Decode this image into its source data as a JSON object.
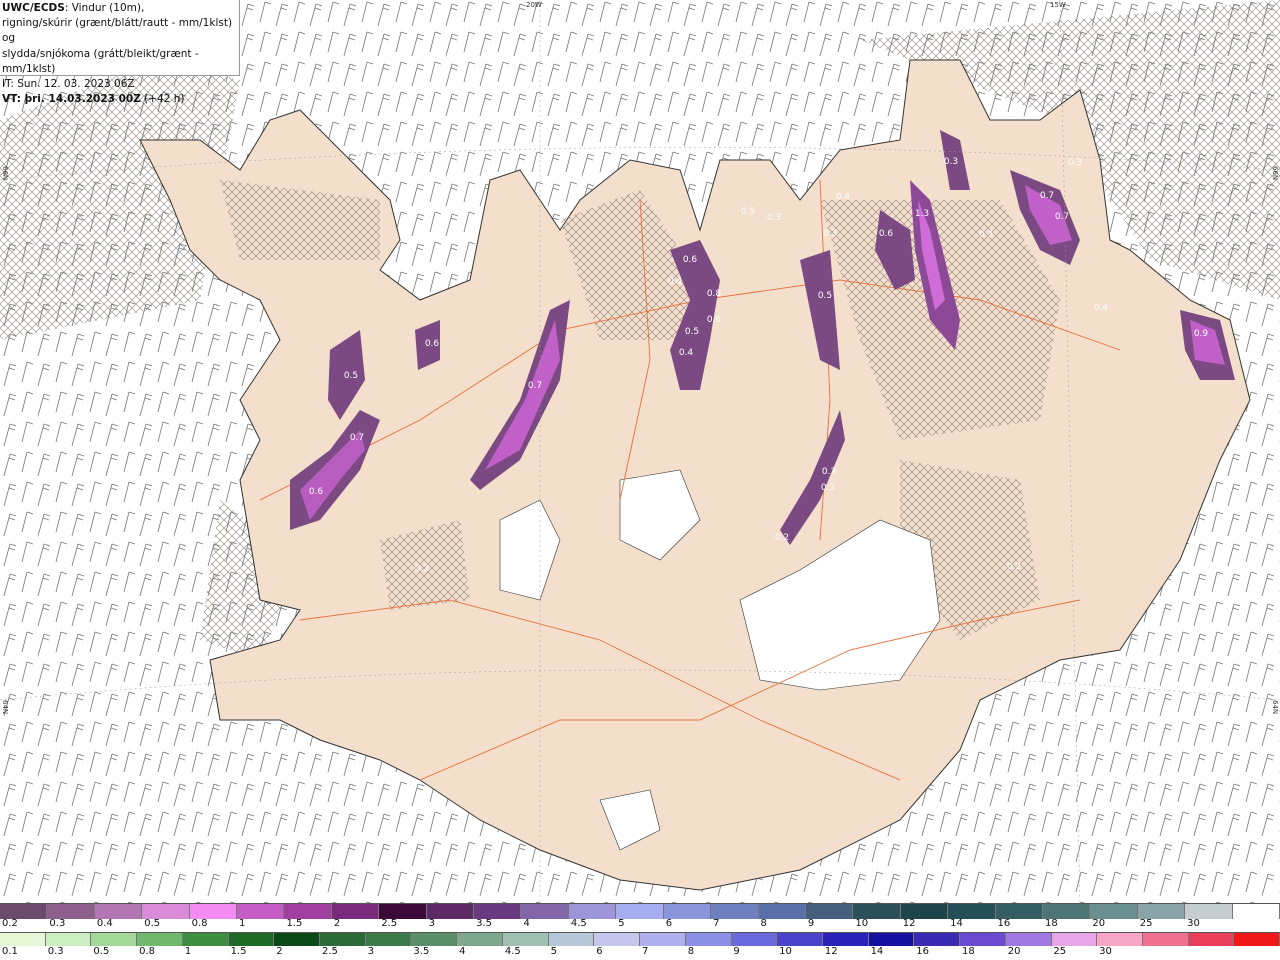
{
  "info": {
    "model": "UWC/ECDS",
    "desc_1": ": Vindur (10m),",
    "desc_2": "rigning/skúrir (grænt/blátt/rautt - mm/1klst) og",
    "desc_3": "slydda/snjókoma (grátt/bleikt/grænt - mm/1klst)",
    "it": "IT: Sun. 12. 03. 2023 06Z",
    "vt_label": "VT: þri. 14.03.2023 00Z",
    "vt_offset": " (+42 h)"
  },
  "graticule": {
    "lon_20w": "20W",
    "lon_15w": "15W",
    "lat_66n_left": "66N",
    "lat_66n_right": "66N",
    "lat_64n_left": "64N",
    "lat_64n_right": "64N"
  },
  "precip_labels": [
    {
      "text": "0.5"
    },
    {
      "text": "0.7"
    },
    {
      "text": "0.6"
    },
    {
      "text": "0.6"
    },
    {
      "text": "0.7"
    },
    {
      "text": "0.2"
    },
    {
      "text": "0.6"
    },
    {
      "text": "0.4"
    },
    {
      "text": "0.8"
    },
    {
      "text": "0.6"
    },
    {
      "text": "0.5"
    },
    {
      "text": "0.4"
    },
    {
      "text": "0.5"
    },
    {
      "text": "0.3"
    },
    {
      "text": "0.4"
    },
    {
      "text": "0.5"
    },
    {
      "text": "0.3"
    },
    {
      "text": "0.6"
    },
    {
      "text": "1.3"
    },
    {
      "text": "0.3"
    },
    {
      "text": "0.3"
    },
    {
      "text": "0.7"
    },
    {
      "text": "0.7"
    },
    {
      "text": "0.3"
    },
    {
      "text": "0.4"
    },
    {
      "text": "0.9"
    },
    {
      "text": "0.3"
    },
    {
      "text": "0.3"
    },
    {
      "text": "0.2"
    },
    {
      "text": "0.2"
    }
  ],
  "legend": {
    "snow_colors": [
      "#6b4a6e",
      "#8c5f8c",
      "#b277b2",
      "#d98ad9",
      "#f28bf2",
      "#c65cc6",
      "#a13fa1",
      "#7a2a7a",
      "#3b0a3b",
      "#5e2a66",
      "#6a3a80",
      "#8366a8",
      "#9e94d8",
      "#a6acf0",
      "#8a96dc",
      "#6e80c0",
      "#5a70a8",
      "#44607e",
      "#2c4f5c",
      "#1c4449",
      "#244f56",
      "#355e63",
      "#4d7576",
      "#6a8f8f",
      "#8aa3a6",
      "#c4cdd1",
      "#ffffff"
    ],
    "snow_labels": [
      "0.2",
      "0.3",
      "0.4",
      "0.5",
      "0.8",
      "1",
      "1.5",
      "2",
      "2.5",
      "3",
      "3.5",
      "4",
      "4.5",
      "5",
      "6",
      "7",
      "8",
      "9",
      "10",
      "12",
      "14",
      "16",
      "18",
      "20",
      "25",
      "30"
    ],
    "rain_colors": [
      "#e6f7d7",
      "#cdeec0",
      "#a4d99a",
      "#6fb86e",
      "#3f8f43",
      "#1f6a26",
      "#0b4a18",
      "#2d6a3a",
      "#3d7a4a",
      "#5a8f6a",
      "#7ea88e",
      "#9fbfb0",
      "#b6c8d8",
      "#c4c6ec",
      "#b0b0ee",
      "#8c90e6",
      "#6a6adc",
      "#4a44cc",
      "#2a22b8",
      "#1410a0",
      "#3a2ab4",
      "#6a4ad0",
      "#a07ae0",
      "#e8a6e8",
      "#f7a6c8",
      "#f07090",
      "#e83e5a",
      "#f01818"
    ],
    "rain_labels": [
      "0.1",
      "0.3",
      "0.5",
      "0.8",
      "1",
      "1.5",
      "2",
      "2.5",
      "3",
      "3.5",
      "4",
      "4.5",
      "5",
      "6",
      "7",
      "8",
      "9",
      "10",
      "12",
      "14",
      "16",
      "18",
      "20",
      "25",
      "30"
    ]
  }
}
